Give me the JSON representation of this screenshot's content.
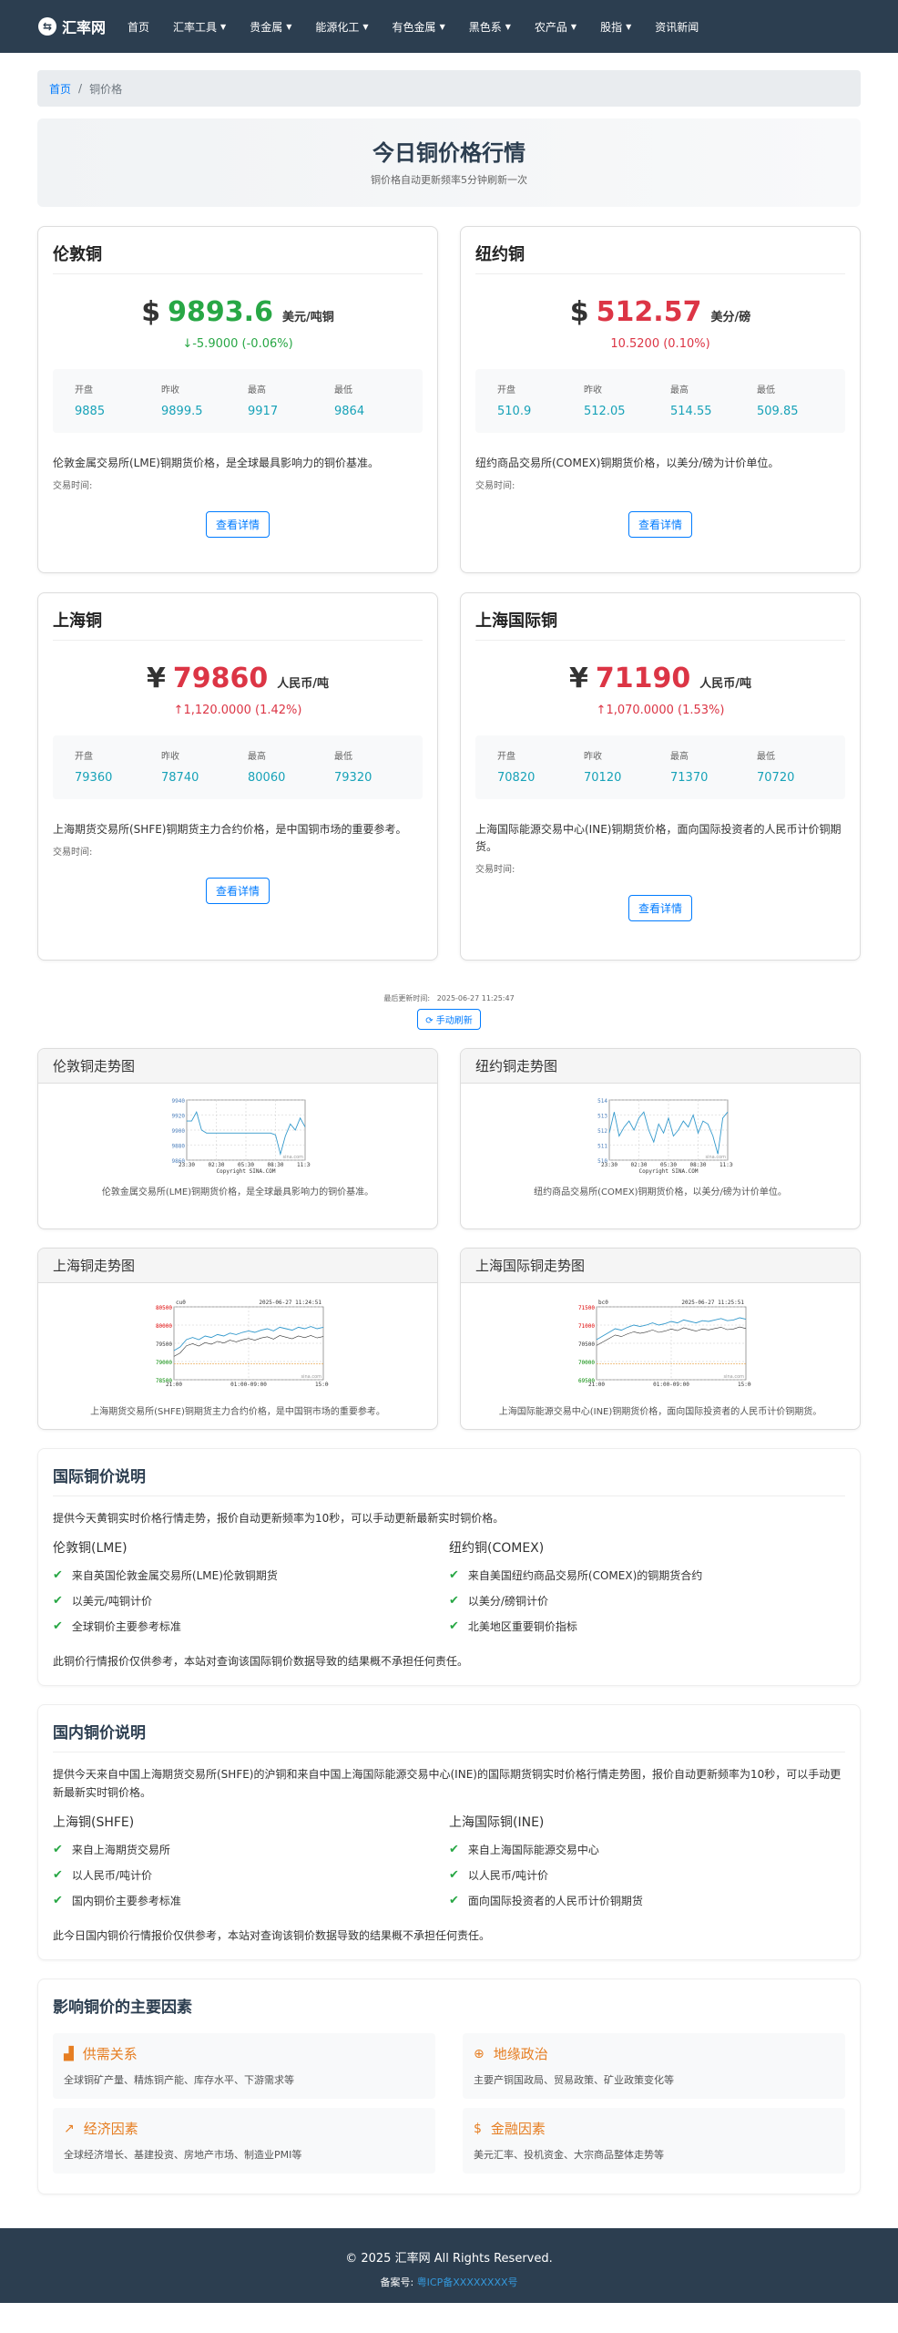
{
  "nav": {
    "brand": "汇率网",
    "items": [
      {
        "label": "首页",
        "dropdown": false
      },
      {
        "label": "汇率工具",
        "dropdown": true
      },
      {
        "label": "贵金属",
        "dropdown": true
      },
      {
        "label": "能源化工",
        "dropdown": true
      },
      {
        "label": "有色金属",
        "dropdown": true
      },
      {
        "label": "黑色系",
        "dropdown": true
      },
      {
        "label": "农产品",
        "dropdown": true
      },
      {
        "label": "股指",
        "dropdown": true
      },
      {
        "label": "资讯新闻",
        "dropdown": false
      }
    ]
  },
  "breadcrumb": {
    "home": "首页",
    "sep": "/",
    "current": "铜价格"
  },
  "hero": {
    "title": "今日铜价格行情",
    "subtitle": "铜价格自动更新频率5分钟刷新一次"
  },
  "cards": [
    {
      "title": "伦敦铜",
      "currency": "$",
      "price": "9893.6",
      "unit": "美元/吨铜",
      "change": "↓-5.9000 (-0.06%)",
      "dir": "down",
      "stats": [
        {
          "label": "开盘",
          "value": "9885"
        },
        {
          "label": "昨收",
          "value": "9899.5"
        },
        {
          "label": "最高",
          "value": "9917"
        },
        {
          "label": "最低",
          "value": "9864"
        }
      ],
      "desc": "伦敦金属交易所(LME)铜期货价格，是全球最具影响力的铜价基准。",
      "time": "交易时间:",
      "button": "查看详情"
    },
    {
      "title": "纽约铜",
      "currency": "$",
      "price": "512.57",
      "unit": "美分/磅",
      "change": "10.5200 (0.10%)",
      "dir": "up",
      "stats": [
        {
          "label": "开盘",
          "value": "510.9"
        },
        {
          "label": "昨收",
          "value": "512.05"
        },
        {
          "label": "最高",
          "value": "514.55"
        },
        {
          "label": "最低",
          "value": "509.85"
        }
      ],
      "desc": "纽约商品交易所(COMEX)铜期货价格，以美分/磅为计价单位。",
      "time": "交易时间:",
      "button": "查看详情"
    },
    {
      "title": "上海铜",
      "currency": "¥",
      "price": "79860",
      "unit": "人民币/吨",
      "change": "↑1,120.0000 (1.42%)",
      "dir": "up",
      "stats": [
        {
          "label": "开盘",
          "value": "79360"
        },
        {
          "label": "昨收",
          "value": "78740"
        },
        {
          "label": "最高",
          "value": "80060"
        },
        {
          "label": "最低",
          "value": "79320"
        }
      ],
      "desc": "上海期货交易所(SHFE)铜期货主力合约价格，是中国铜市场的重要参考。",
      "time": "交易时间:",
      "button": "查看详情"
    },
    {
      "title": "上海国际铜",
      "currency": "¥",
      "price": "71190",
      "unit": "人民币/吨",
      "change": "↑1,070.0000 (1.53%)",
      "dir": "up",
      "stats": [
        {
          "label": "开盘",
          "value": "70820"
        },
        {
          "label": "昨收",
          "value": "70120"
        },
        {
          "label": "最高",
          "value": "71370"
        },
        {
          "label": "最低",
          "value": "70720"
        }
      ],
      "desc": "上海国际能源交易中心(INE)铜期货价格，面向国际投资者的人民币计价铜期货。",
      "time": "交易时间:",
      "button": "查看详情"
    }
  ],
  "update": {
    "label": "最后更新时间:",
    "time": "2025-06-27 11:25:47",
    "button": "手动刷新"
  },
  "trends": [
    {
      "title": "伦敦铜走势图",
      "caption": "伦敦金属交易所(LME)铜期货价格，是全球最具影响力的铜价基准。",
      "chart": {
        "yticks": [
          "9940",
          "9920",
          "9900",
          "9880",
          "9860"
        ],
        "xticks": [
          "23:30",
          "02:30",
          "05:30",
          "08:30",
          "11:30"
        ],
        "footer": "Copyright  SINA.COM",
        "watermark": "sina.com"
      }
    },
    {
      "title": "纽约铜走势图",
      "caption": "纽约商品交易所(COMEX)铜期货价格，以美分/磅为计价单位。",
      "chart": {
        "yticks": [
          "514",
          "513",
          "512",
          "511",
          "510"
        ],
        "xticks": [
          "23:30",
          "02:30",
          "05:30",
          "08:30",
          "11:30"
        ],
        "footer": "Copyright  SINA.COM",
        "watermark": "sina.com"
      }
    },
    {
      "title": "上海铜走势图",
      "caption": "上海期货交易所(SHFE)铜期货主力合约价格，是中国铜市场的重要参考。",
      "chart": {
        "code": "cu0",
        "stamp": "2025-06-27 11:24:51",
        "yticks": [
          "80500",
          "80000",
          "79500",
          "79000",
          "78500"
        ],
        "xticks": [
          "21:00",
          "01:00-09:00",
          "15:00"
        ],
        "watermark": "sina.com"
      }
    },
    {
      "title": "上海国际铜走势图",
      "caption": "上海国际能源交易中心(INE)铜期货价格，面向国际投资者的人民币计价铜期货。",
      "chart": {
        "code": "bc0",
        "stamp": "2025-06-27 11:25:51",
        "yticks": [
          "71500",
          "71000",
          "70500",
          "70000",
          "69500"
        ],
        "xticks": [
          "21:00",
          "01:00-09:00",
          "15:00"
        ],
        "watermark": "sina.com"
      }
    }
  ],
  "intl": {
    "title": "国际铜价说明",
    "intro": "提供今天黄铜实时价格行情走势，报价自动更新频率为10秒，可以手动更新最新实时铜价格。",
    "cols": [
      {
        "title": "伦敦铜(LME)",
        "items": [
          "来自英国伦敦金属交易所(LME)伦敦铜期货",
          "以美元/吨铜计价",
          "全球铜价主要参考标准"
        ]
      },
      {
        "title": "纽约铜(COMEX)",
        "items": [
          "来自美国纽约商品交易所(COMEX)的铜期货合约",
          "以美分/磅铜计价",
          "北美地区重要铜价指标"
        ]
      }
    ],
    "disclaimer": "此铜价行情报价仅供参考，本站对查询该国际铜价数据导致的结果概不承担任何责任。"
  },
  "domestic": {
    "title": "国内铜价说明",
    "intro": "提供今天来自中国上海期货交易所(SHFE)的沪铜和来自中国上海国际能源交易中心(INE)的国际期货铜实时价格行情走势图，报价自动更新频率为10秒，可以手动更新最新实时铜价格。",
    "cols": [
      {
        "title": "上海铜(SHFE)",
        "items": [
          "来自上海期货交易所",
          "以人民币/吨计价",
          "国内铜价主要参考标准"
        ]
      },
      {
        "title": "上海国际铜(INE)",
        "items": [
          "来自上海国际能源交易中心",
          "以人民币/吨计价",
          "面向国际投资者的人民币计价铜期货"
        ]
      }
    ],
    "disclaimer": "此今日国内铜价行情报价仅供参考，本站对查询该铜价数据导致的结果概不承担任何责任。"
  },
  "factors": {
    "title": "影响铜价的主要因素",
    "items": [
      {
        "icon": "factory-icon",
        "glyph": "▟",
        "title": "供需关系",
        "desc": "全球铜矿产量、精炼铜产能、库存水平、下游需求等"
      },
      {
        "icon": "globe-icon",
        "glyph": "⊕",
        "title": "地缘政治",
        "desc": "主要产铜国政局、贸易政策、矿业政策变化等"
      },
      {
        "icon": "line-chart-icon",
        "glyph": "↗",
        "title": "经济因素",
        "desc": "全球经济增长、基建投资、房地产市场、制造业PMI等"
      },
      {
        "icon": "dollar-icon",
        "glyph": "$",
        "title": "金融因素",
        "desc": "美元汇率、投机资金、大宗商品整体走势等"
      }
    ]
  },
  "footer": {
    "copyright": "© 2025 汇率网 All Rights Reserved.",
    "icp_label": "备案号:",
    "icp_value": "粤ICP备XXXXXXXX号"
  },
  "colors": {
    "nav_bg": "#2c3e50",
    "up": "#dc3545",
    "down": "#28a745",
    "accent": "#007bff",
    "factor": "#e67e22"
  }
}
